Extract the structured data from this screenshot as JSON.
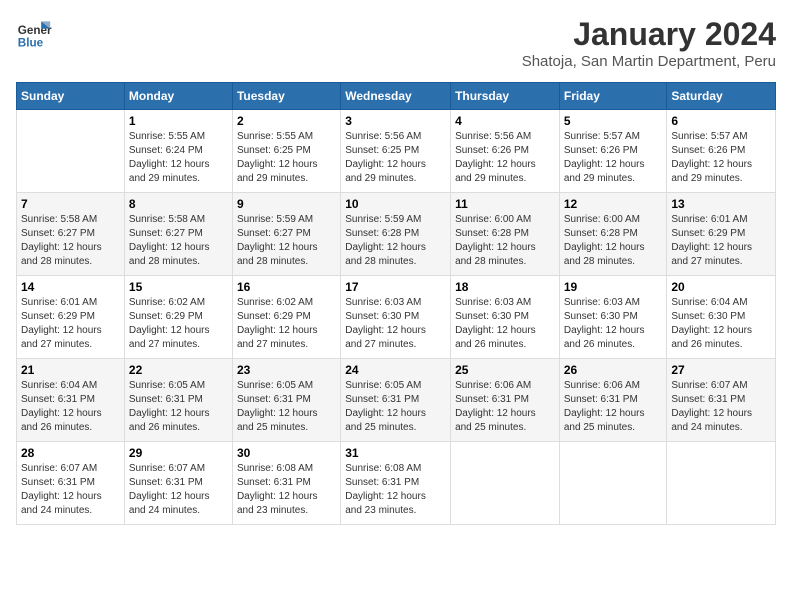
{
  "logo": {
    "line1": "General",
    "line2": "Blue"
  },
  "title": "January 2024",
  "subtitle": "Shatoja, San Martin Department, Peru",
  "days_header": [
    "Sunday",
    "Monday",
    "Tuesday",
    "Wednesday",
    "Thursday",
    "Friday",
    "Saturday"
  ],
  "weeks": [
    [
      {
        "num": "",
        "info": ""
      },
      {
        "num": "1",
        "info": "Sunrise: 5:55 AM\nSunset: 6:24 PM\nDaylight: 12 hours\nand 29 minutes."
      },
      {
        "num": "2",
        "info": "Sunrise: 5:55 AM\nSunset: 6:25 PM\nDaylight: 12 hours\nand 29 minutes."
      },
      {
        "num": "3",
        "info": "Sunrise: 5:56 AM\nSunset: 6:25 PM\nDaylight: 12 hours\nand 29 minutes."
      },
      {
        "num": "4",
        "info": "Sunrise: 5:56 AM\nSunset: 6:26 PM\nDaylight: 12 hours\nand 29 minutes."
      },
      {
        "num": "5",
        "info": "Sunrise: 5:57 AM\nSunset: 6:26 PM\nDaylight: 12 hours\nand 29 minutes."
      },
      {
        "num": "6",
        "info": "Sunrise: 5:57 AM\nSunset: 6:26 PM\nDaylight: 12 hours\nand 29 minutes."
      }
    ],
    [
      {
        "num": "7",
        "info": "Sunrise: 5:58 AM\nSunset: 6:27 PM\nDaylight: 12 hours\nand 28 minutes."
      },
      {
        "num": "8",
        "info": "Sunrise: 5:58 AM\nSunset: 6:27 PM\nDaylight: 12 hours\nand 28 minutes."
      },
      {
        "num": "9",
        "info": "Sunrise: 5:59 AM\nSunset: 6:27 PM\nDaylight: 12 hours\nand 28 minutes."
      },
      {
        "num": "10",
        "info": "Sunrise: 5:59 AM\nSunset: 6:28 PM\nDaylight: 12 hours\nand 28 minutes."
      },
      {
        "num": "11",
        "info": "Sunrise: 6:00 AM\nSunset: 6:28 PM\nDaylight: 12 hours\nand 28 minutes."
      },
      {
        "num": "12",
        "info": "Sunrise: 6:00 AM\nSunset: 6:28 PM\nDaylight: 12 hours\nand 28 minutes."
      },
      {
        "num": "13",
        "info": "Sunrise: 6:01 AM\nSunset: 6:29 PM\nDaylight: 12 hours\nand 27 minutes."
      }
    ],
    [
      {
        "num": "14",
        "info": "Sunrise: 6:01 AM\nSunset: 6:29 PM\nDaylight: 12 hours\nand 27 minutes."
      },
      {
        "num": "15",
        "info": "Sunrise: 6:02 AM\nSunset: 6:29 PM\nDaylight: 12 hours\nand 27 minutes."
      },
      {
        "num": "16",
        "info": "Sunrise: 6:02 AM\nSunset: 6:29 PM\nDaylight: 12 hours\nand 27 minutes."
      },
      {
        "num": "17",
        "info": "Sunrise: 6:03 AM\nSunset: 6:30 PM\nDaylight: 12 hours\nand 27 minutes."
      },
      {
        "num": "18",
        "info": "Sunrise: 6:03 AM\nSunset: 6:30 PM\nDaylight: 12 hours\nand 26 minutes."
      },
      {
        "num": "19",
        "info": "Sunrise: 6:03 AM\nSunset: 6:30 PM\nDaylight: 12 hours\nand 26 minutes."
      },
      {
        "num": "20",
        "info": "Sunrise: 6:04 AM\nSunset: 6:30 PM\nDaylight: 12 hours\nand 26 minutes."
      }
    ],
    [
      {
        "num": "21",
        "info": "Sunrise: 6:04 AM\nSunset: 6:31 PM\nDaylight: 12 hours\nand 26 minutes."
      },
      {
        "num": "22",
        "info": "Sunrise: 6:05 AM\nSunset: 6:31 PM\nDaylight: 12 hours\nand 26 minutes."
      },
      {
        "num": "23",
        "info": "Sunrise: 6:05 AM\nSunset: 6:31 PM\nDaylight: 12 hours\nand 25 minutes."
      },
      {
        "num": "24",
        "info": "Sunrise: 6:05 AM\nSunset: 6:31 PM\nDaylight: 12 hours\nand 25 minutes."
      },
      {
        "num": "25",
        "info": "Sunrise: 6:06 AM\nSunset: 6:31 PM\nDaylight: 12 hours\nand 25 minutes."
      },
      {
        "num": "26",
        "info": "Sunrise: 6:06 AM\nSunset: 6:31 PM\nDaylight: 12 hours\nand 25 minutes."
      },
      {
        "num": "27",
        "info": "Sunrise: 6:07 AM\nSunset: 6:31 PM\nDaylight: 12 hours\nand 24 minutes."
      }
    ],
    [
      {
        "num": "28",
        "info": "Sunrise: 6:07 AM\nSunset: 6:31 PM\nDaylight: 12 hours\nand 24 minutes."
      },
      {
        "num": "29",
        "info": "Sunrise: 6:07 AM\nSunset: 6:31 PM\nDaylight: 12 hours\nand 24 minutes."
      },
      {
        "num": "30",
        "info": "Sunrise: 6:08 AM\nSunset: 6:31 PM\nDaylight: 12 hours\nand 23 minutes."
      },
      {
        "num": "31",
        "info": "Sunrise: 6:08 AM\nSunset: 6:31 PM\nDaylight: 12 hours\nand 23 minutes."
      },
      {
        "num": "",
        "info": ""
      },
      {
        "num": "",
        "info": ""
      },
      {
        "num": "",
        "info": ""
      }
    ]
  ]
}
